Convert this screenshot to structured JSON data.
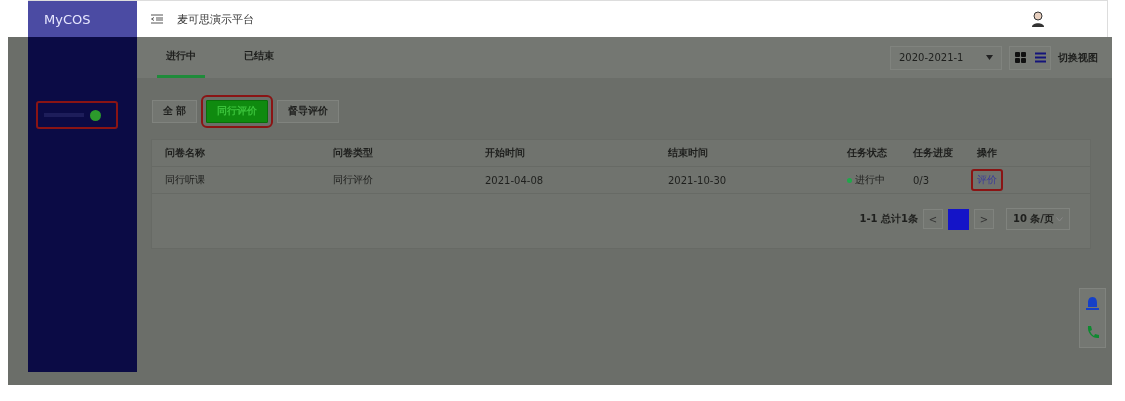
{
  "header": {
    "logo": "MyCOS",
    "title": "麦可思演示平台"
  },
  "sidebar": {
    "items": [
      {
        "highlighted": true,
        "badge": true
      }
    ]
  },
  "tabs": [
    {
      "label": "进行中",
      "selected": true
    },
    {
      "label": "已结束",
      "selected": false
    }
  ],
  "term_select": {
    "value": "2020-2021-1"
  },
  "view_toggle": {
    "grid_selected": false,
    "list_selected": true,
    "label": "切换视图"
  },
  "filters": [
    {
      "label": "全 部",
      "selected": false,
      "highlighted": false
    },
    {
      "label": "同行评价",
      "selected": true,
      "highlighted": true
    },
    {
      "label": "督导评价",
      "selected": false,
      "highlighted": false
    }
  ],
  "table": {
    "columns": [
      "问卷名称",
      "问卷类型",
      "开始时间",
      "结束时间",
      "任务状态",
      "任务进度",
      "操作"
    ],
    "rows": [
      {
        "cells": [
          "同行听课",
          "同行评价",
          "2021-04-08",
          "2021-10-30"
        ],
        "status": "进行中",
        "color": "#1fa84a",
        "progress": "0/3",
        "action": "评价",
        "action_highlighted": true
      }
    ]
  },
  "pagination": {
    "summary": "1-1 总计1条",
    "prev": "<",
    "pages": [
      {
        "selected": true
      }
    ],
    "next": ">",
    "page_size": "10 条/页"
  }
}
